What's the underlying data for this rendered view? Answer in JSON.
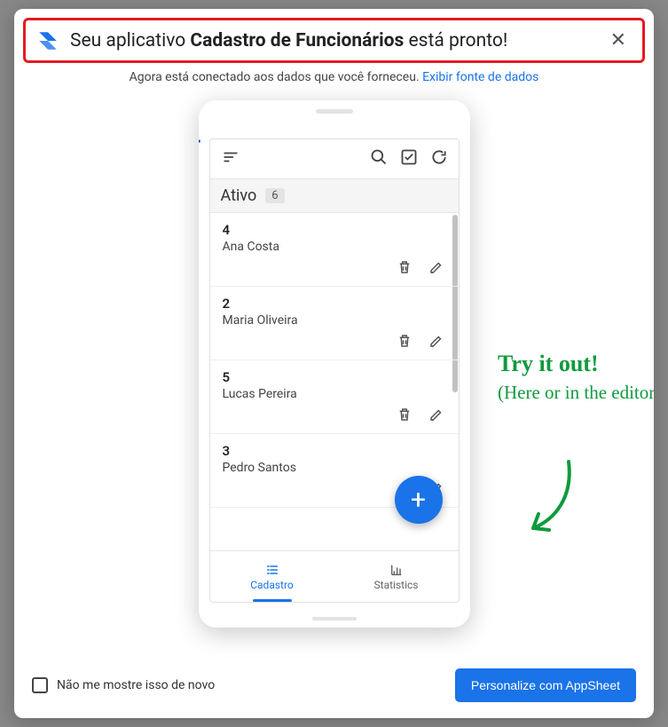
{
  "banner": {
    "prefix": "Seu aplicativo ",
    "app_name": "Cadastro de Funcionários",
    "suffix": " está pronto!"
  },
  "subtext": {
    "text": "Agora está conectado aos dados que você forneceu. ",
    "link": "Exibir fonte de dados"
  },
  "group": {
    "label": "Ativo",
    "count": "6"
  },
  "rows": [
    {
      "id": "4",
      "name": "Ana Costa"
    },
    {
      "id": "2",
      "name": "Maria Oliveira"
    },
    {
      "id": "5",
      "name": "Lucas Pereira"
    },
    {
      "id": "3",
      "name": "Pedro Santos"
    }
  ],
  "nav": {
    "tab1": "Cadastro",
    "tab2": "Statistics"
  },
  "callout": {
    "line1": "Try it out!",
    "line2": "(Here or in the editor)"
  },
  "footer": {
    "checkbox_label": "Não me mostre isso de novo",
    "cta": "Personalize com AppSheet"
  }
}
